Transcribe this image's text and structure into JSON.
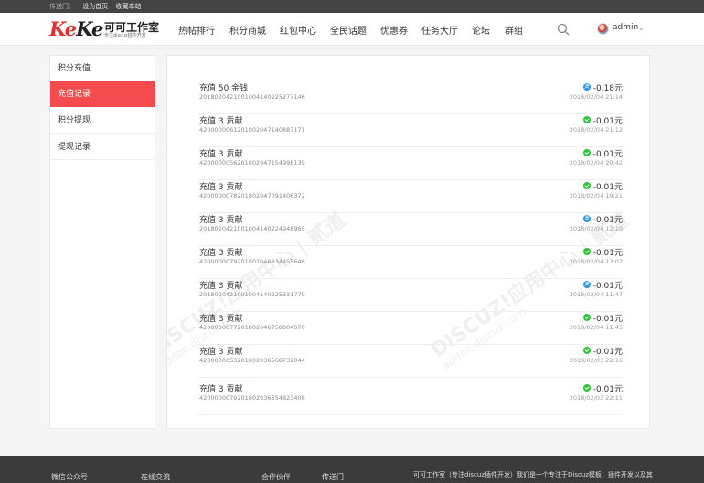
{
  "topbar": {
    "label": "传送门：",
    "set_home": "设为首页",
    "bookmark": "收藏本站"
  },
  "logo": {
    "mark": "KeKe",
    "name": "可可工作室",
    "subtitle": "专注discuz插件开发"
  },
  "nav": [
    "热帖排行",
    "积分商城",
    "红包中心",
    "全民话题",
    "优惠券",
    "任务大厅",
    "论坛",
    "群组"
  ],
  "user": {
    "name": "admin"
  },
  "sidebar": {
    "items": [
      {
        "label": "积分充值",
        "active": false
      },
      {
        "label": "充值记录",
        "active": true
      },
      {
        "label": "积分提现",
        "active": false
      },
      {
        "label": "提现记录",
        "active": false
      }
    ]
  },
  "records": [
    {
      "title": "充值 50 金钱",
      "order": "2018020421001004140225277146",
      "pay": "alipay",
      "amount": "-0.18元",
      "time": "2018/02/04 21:14"
    },
    {
      "title": "充值 3 贡献",
      "order": "4200000061201802047140887171",
      "pay": "wechat",
      "amount": "-0.01元",
      "time": "2018/02/04 21:12"
    },
    {
      "title": "充值 3 贡献",
      "order": "4200000056201802047154998139",
      "pay": "wechat",
      "amount": "-0.01元",
      "time": "2018/02/04 20:42"
    },
    {
      "title": "充值 3 贡献",
      "order": "4200000078201802047091406372",
      "pay": "wechat",
      "amount": "-0.01元",
      "time": "2018/02/04 19:21"
    },
    {
      "title": "充值 3 贡献",
      "order": "2018020421001004140224948965",
      "pay": "alipay",
      "amount": "-0.01元",
      "time": "2018/02/04 12:10"
    },
    {
      "title": "充值 3 贡献",
      "order": "4200000079201802046834455646",
      "pay": "wechat",
      "amount": "-0.01元",
      "time": "2018/02/04 12:07"
    },
    {
      "title": "充值 3 贡献",
      "order": "2018020421001004140225331779",
      "pay": "alipay",
      "amount": "-0.01元",
      "time": "2018/02/04 11:47"
    },
    {
      "title": "充值 3 贡献",
      "order": "4200000077201802046758004570",
      "pay": "wechat",
      "amount": "-0.01元",
      "time": "2018/02/04 11:45"
    },
    {
      "title": "充值 3 贡献",
      "order": "4200000053201802036568732044",
      "pay": "wechat",
      "amount": "-0.01元",
      "time": "2018/02/03 22:16"
    },
    {
      "title": "充值 3 贡献",
      "order": "4200000079201802036554823408",
      "pay": "wechat",
      "amount": "-0.01元",
      "time": "2018/02/03 22:11"
    }
  ],
  "watermark": {
    "text": "DISCUZ!应用中心 | 贰道",
    "url": "addon.discuz.com"
  },
  "footer": {
    "items": [
      "微信公众号",
      "在线交流",
      "合作伙伴",
      "传送门",
      "可可工作室（专注discuz插件开发）我们是一个专注于Discuz模板，插件开发以及其"
    ]
  },
  "colors": {
    "accent": "#f44c4e",
    "wechat": "#2dc33b",
    "alipay": "#2a8fde",
    "topbar": "#444444",
    "footer": "#3b3b3b"
  }
}
